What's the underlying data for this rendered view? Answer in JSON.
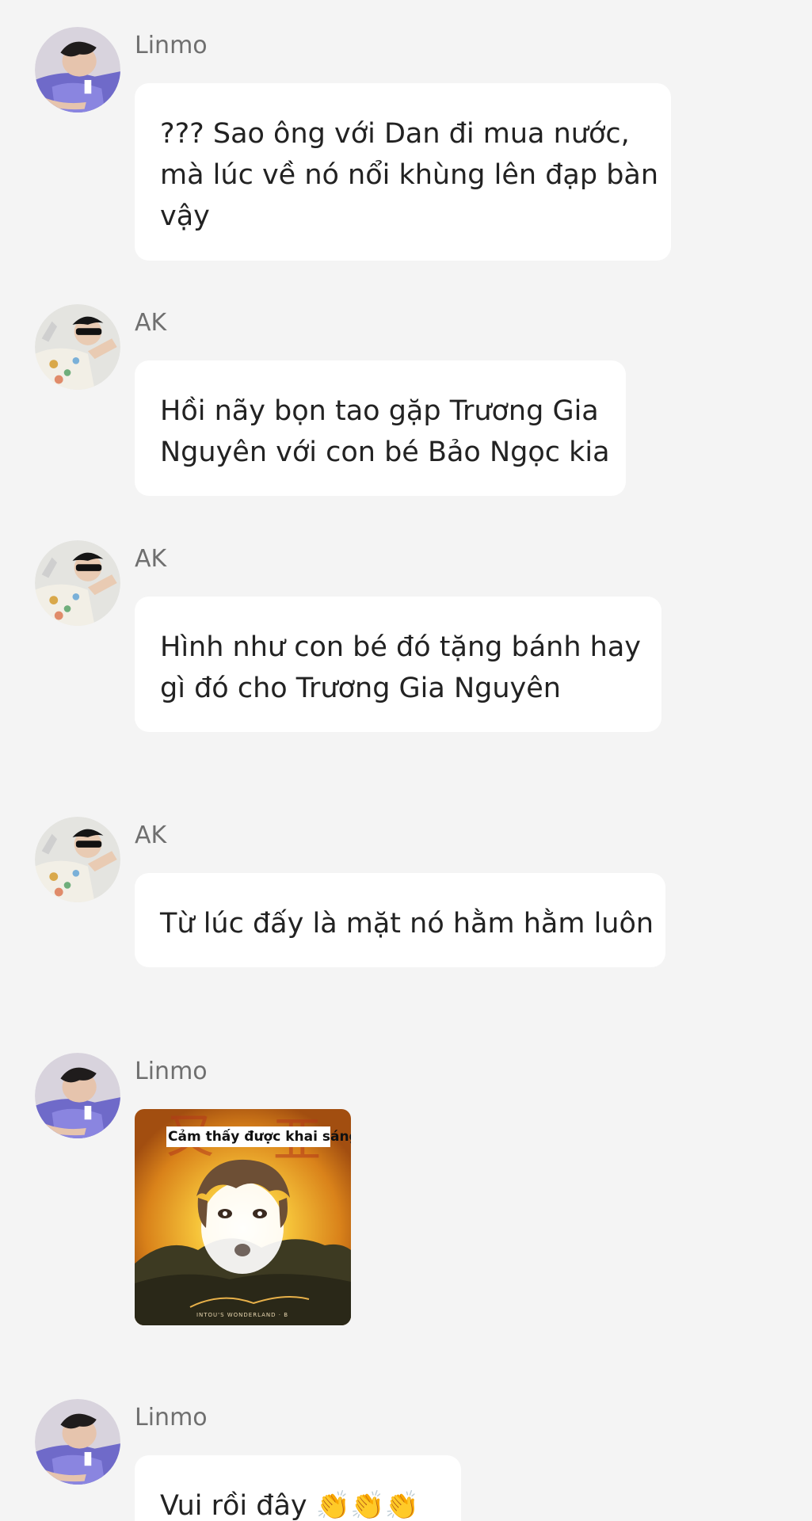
{
  "messages": [
    {
      "sender": "Linmo",
      "lines": [
        "??? Sao ông với Dan đi mua nước,",
        "mà lúc về nó nổi khùng lên đạp bàn",
        "vậy"
      ]
    },
    {
      "sender": "AK",
      "lines": [
        "Hồi nãy bọn tao gặp Trương Gia",
        "Nguyên với con bé Bảo Ngọc kia"
      ]
    },
    {
      "sender": "AK",
      "lines": [
        "Hình như con bé đó tặng bánh hay",
        "gì đó cho Trương Gia Nguyên"
      ]
    },
    {
      "sender": "AK",
      "lines": [
        "Từ lúc đấy là mặt nó hằm hằm luôn"
      ]
    },
    {
      "sender": "Linmo",
      "sticker": {
        "caption": "Cảm thấy được khai sáng",
        "footer": "INTOU'S WONDERLAND · B"
      }
    },
    {
      "sender": "Linmo",
      "lines": [
        "Vui rồi đây 👏👏👏"
      ]
    }
  ],
  "colors": {
    "background": "#f4f4f4",
    "bubble": "#ffffff",
    "text": "#222222",
    "sender": "#6f6f6f"
  },
  "icons": {
    "linmo_avatar": "avatar-purple-shirt",
    "ak_avatar": "avatar-sunglasses",
    "sticker": "enlightened-face-meme"
  }
}
